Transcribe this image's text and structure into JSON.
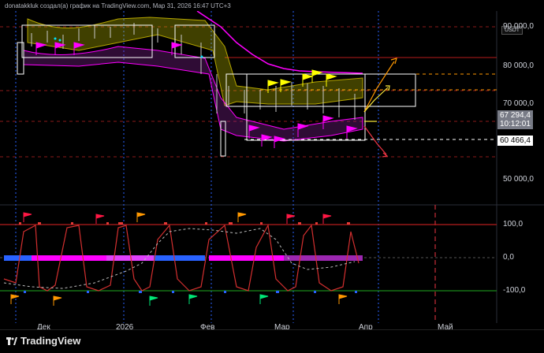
{
  "header": {
    "text": "donatakkluk создал(а) график на TradingView.com, Мар 31, 2026 16:47 UTC+3"
  },
  "currency": "USDT",
  "price_axis": [
    {
      "label": "90 000,0",
      "value": 90000
    },
    {
      "label": "80 000,0",
      "value": 80000
    },
    {
      "label": "70 000,0",
      "value": 70000
    },
    {
      "label": "50 000,0",
      "value": 50000
    }
  ],
  "current_price": {
    "price": "67 294,4",
    "countdown": "10:12:01",
    "bg": "#787b86"
  },
  "level_tag": {
    "label": "60 466,4",
    "bg": "#ffffff",
    "color": "#000000"
  },
  "oscillator_axis": [
    {
      "label": "100,0",
      "value": 100
    },
    {
      "label": "0,0",
      "value": 0
    },
    {
      "label": "-100,0",
      "value": -100
    }
  ],
  "time_axis": [
    "Дек",
    "2026",
    "Фев",
    "Мар",
    "Апр",
    "Май"
  ],
  "footer": {
    "brand": "TradingView"
  },
  "colors": {
    "magenta": "#ff00ff",
    "yellow": "#ffff00",
    "red": "#b71c1c",
    "orange": "#ff9800",
    "blue": "#2962ff"
  }
}
